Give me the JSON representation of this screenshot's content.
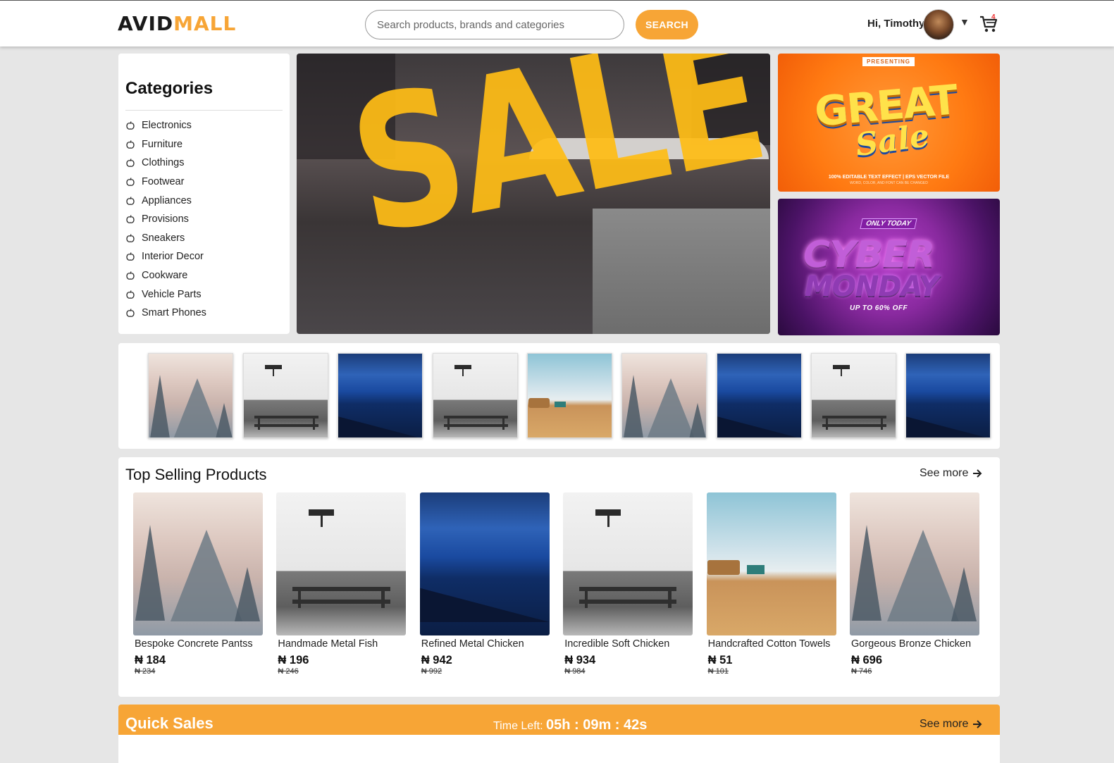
{
  "header": {
    "logo_part1": "AVID",
    "logo_part2": "MALL",
    "search_placeholder": "Search products, brands and categories",
    "search_button": "SEARCH",
    "greeting": "Hi, Timothy",
    "caret": "▼",
    "cart_count": "4"
  },
  "categories": {
    "title": "Categories",
    "items": [
      {
        "label": "Electronics"
      },
      {
        "label": "Furniture"
      },
      {
        "label": "Clothings"
      },
      {
        "label": "Footwear"
      },
      {
        "label": "Appliances"
      },
      {
        "label": "Provisions"
      },
      {
        "label": "Sneakers"
      },
      {
        "label": "Interior Decor"
      },
      {
        "label": "Cookware"
      },
      {
        "label": "Vehicle Parts"
      },
      {
        "label": "Smart Phones"
      }
    ]
  },
  "banners": {
    "main_text": "SALE",
    "great": {
      "tag": "PRESENTING",
      "word1": "GREAT",
      "word2": "Sale",
      "foot1": "100% EDITABLE TEXT EFFECT | EPS VECTOR FILE",
      "foot2": "WORD, COLOR, AND FONT CAN BE CHANGED"
    },
    "cyber": {
      "tag": "ONLY TODAY",
      "word1": "CYBER",
      "word2": "MONDAY",
      "offer": "UP TO 60% OFF"
    }
  },
  "carousel": {
    "items": [
      "trees",
      "bench",
      "ocean",
      "bench",
      "field",
      "trees",
      "ocean",
      "bench",
      "ocean"
    ]
  },
  "top_selling": {
    "title": "Top Selling Products",
    "see_more": "See more",
    "products": [
      {
        "name": "Bespoke Concrete Pantss",
        "price": "₦ 184",
        "old_price": "₦ 234",
        "image": "trees"
      },
      {
        "name": "Handmade Metal Fish",
        "price": "₦ 196",
        "old_price": "₦ 246",
        "image": "bench"
      },
      {
        "name": "Refined Metal Chicken",
        "price": "₦ 942",
        "old_price": "₦ 992",
        "image": "ocean"
      },
      {
        "name": "Incredible Soft Chicken",
        "price": "₦ 934",
        "old_price": "₦ 984",
        "image": "bench"
      },
      {
        "name": "Handcrafted Cotton Towels",
        "price": "₦ 51",
        "old_price": "₦ 101",
        "image": "field"
      },
      {
        "name": "Gorgeous Bronze Chicken",
        "price": "₦ 696",
        "old_price": "₦ 746",
        "image": "trees"
      }
    ]
  },
  "quick_sales": {
    "title": "Quick Sales",
    "time_label": "Time Left: ",
    "time_value": "05h : 09m : 42s",
    "see_more": "See more"
  },
  "colors": {
    "accent": "#f7a536",
    "background": "#e6e6e6"
  },
  "icons": {
    "cart": "cart-icon",
    "arrow": "arrow-right-icon",
    "category": "apple-icon"
  }
}
